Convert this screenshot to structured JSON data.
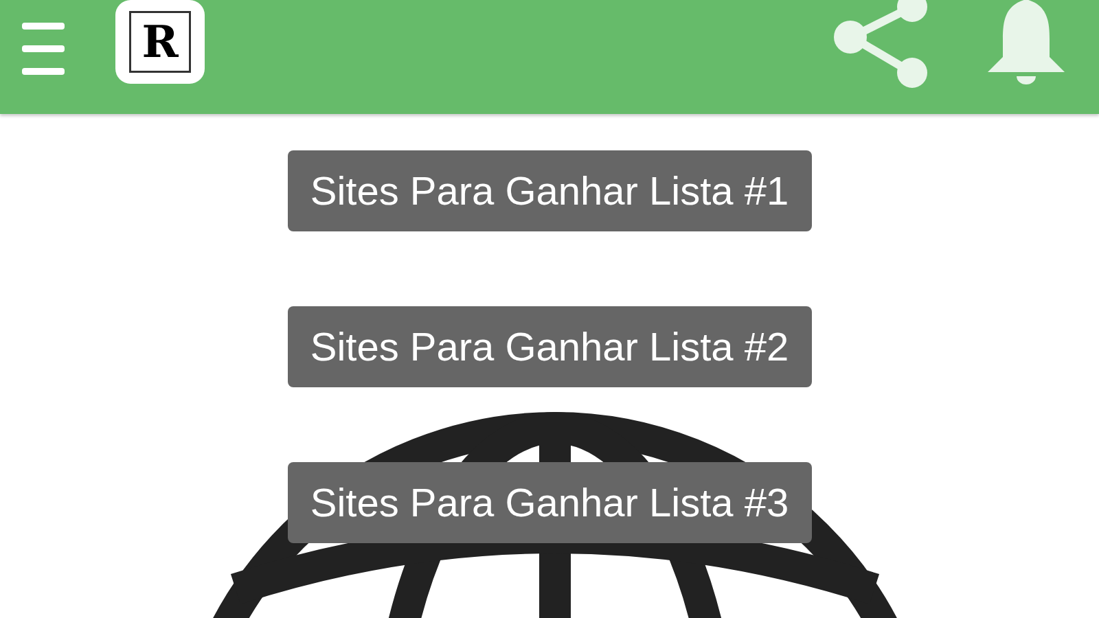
{
  "app_bar": {
    "logo": {
      "letter": "R"
    }
  },
  "buttons": [
    {
      "label": "Sites Para Ganhar Lista #1"
    },
    {
      "label": "Sites Para Ganhar Lista #2"
    },
    {
      "label": "Sites Para Ganhar Lista #3"
    }
  ]
}
